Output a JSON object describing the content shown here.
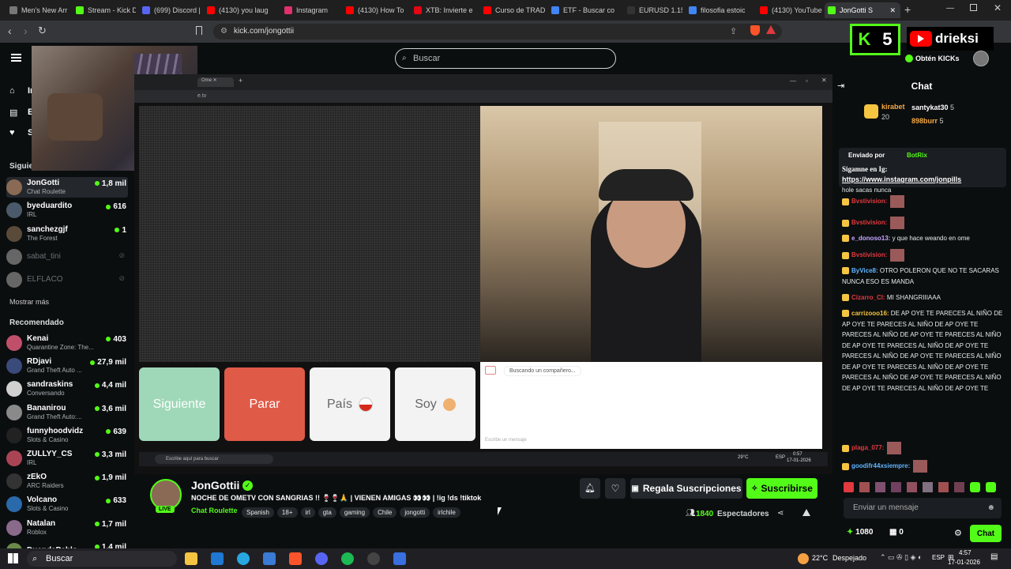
{
  "tabs": [
    {
      "label": "Men's New Arr",
      "color": "#777777"
    },
    {
      "label": "Stream - Kick D",
      "color": "#53fc18"
    },
    {
      "label": "(699) Discord |",
      "color": "#5865f2"
    },
    {
      "label": "(4130) you laug",
      "color": "#ff0000"
    },
    {
      "label": "Instagram",
      "color": "#e1306c"
    },
    {
      "label": "(4130) How To",
      "color": "#ff0000"
    },
    {
      "label": "XTB: Invierte e",
      "color": "#e30613"
    },
    {
      "label": "Curso de TRAD",
      "color": "#ff0000"
    },
    {
      "label": "ETF - Buscar co",
      "color": "#4285f4"
    },
    {
      "label": "EURUSD 1.159",
      "color": "#333333"
    },
    {
      "label": "filosofia estoic",
      "color": "#4285f4"
    },
    {
      "label": "(4130) YouTube",
      "color": "#ff0000"
    },
    {
      "label": "JonGotti S",
      "color": "#53fc18"
    }
  ],
  "address": {
    "url": "kick.com/jongottii"
  },
  "header": {
    "search_placeholder": "Buscar",
    "obtain_kicks": "Obtén KICKs",
    "logo_k": "K",
    "logo_count": "5",
    "yt_overlay": "drieksi"
  },
  "sidebar": {
    "nav": [
      "In",
      "E",
      "S"
    ],
    "following_title": "Siguie",
    "following": [
      {
        "name": "JonGotti",
        "cat": "Chat Roulette",
        "count": "1,8 mil",
        "color": "#8a6a55"
      },
      {
        "name": "byeduardito",
        "cat": "IRL",
        "count": "616",
        "color": "#4a5a6a"
      },
      {
        "name": "sanchezgjf",
        "cat": "The Forest",
        "count": "1",
        "color": "#5a4a3a"
      },
      {
        "name": "sabat_tini",
        "cat": "",
        "count": "",
        "color": "#666666"
      },
      {
        "name": "ELFLACO",
        "cat": "",
        "count": "",
        "color": "#666666"
      }
    ],
    "show_more": "Mostrar más",
    "recommended_title": "Recomendado",
    "recommended": [
      {
        "name": "Kenai",
        "cat": "Quarantine Zone: The...",
        "count": "403",
        "color": "#c0506a"
      },
      {
        "name": "RDjavi",
        "cat": "Grand Theft Auto ...",
        "count": "27,9 mil",
        "color": "#3a4a7a"
      },
      {
        "name": "sandraskins",
        "cat": "Conversando",
        "count": "4,4 mil",
        "color": "#d0d0d0"
      },
      {
        "name": "Bananirou",
        "cat": "Grand Theft Auto:...",
        "count": "3,6 mil",
        "color": "#8a8a8a"
      },
      {
        "name": "funnyhoodvidz",
        "cat": "Slots & Casino",
        "count": "639",
        "color": "#222222"
      },
      {
        "name": "ZULLYY_CS",
        "cat": "IRL",
        "count": "3,3 mil",
        "color": "#aa4455"
      },
      {
        "name": "zEkO",
        "cat": "ARC Raiders",
        "count": "1,9 mil",
        "color": "#333333"
      },
      {
        "name": "Volcano",
        "cat": "Slots & Casino",
        "count": "633",
        "color": "#2a6aaa"
      },
      {
        "name": "Natalan",
        "cat": "Roblox",
        "count": "1,7 mil",
        "color": "#8a6a8a"
      },
      {
        "name": "DuendePablo",
        "cat": "",
        "count": "1,4 mil",
        "color": "#6a8a4a"
      }
    ]
  },
  "player": {
    "buttons": {
      "next": "Siguiente",
      "stop": "Parar",
      "country": "País",
      "soy": "Soy"
    },
    "searching": "Buscando un compañero...",
    "chat_placeholder": "Escribe un mensaje",
    "inner_search": "Escribe aquí para buscar",
    "inner_temp": "29°C",
    "inner_clock": "0:57",
    "inner_date": "17-01-2026",
    "inner_lang": "ESP"
  },
  "stream": {
    "name": "JonGottii",
    "live": "LIVE",
    "title": "NOCHE DE OMETV CON SANGRIAS !! 🍷🍷🙏 | VIENEN AMIGAS 👀👀 | !ig !ds !tiktok",
    "category": "Chat Roulette",
    "tags": [
      "Spanish",
      "18+",
      "irl",
      "gta",
      "gaming",
      "Chile",
      "jongotti",
      "irlchile"
    ],
    "viewers": "1840",
    "viewers_label": "Espectadores",
    "gift_label": "Regala Suscripciones",
    "subscribe_label": "Suscribirse"
  },
  "chat": {
    "title": "Chat",
    "top_gifters": [
      {
        "name": "kirabet",
        "count": "20"
      },
      {
        "name": "santykat30",
        "count": "5"
      },
      {
        "name": "898burr",
        "count": "5"
      }
    ],
    "pinned_by": "Enviado por",
    "pinned_user": "BotRix",
    "pinned_text": "Sigamne en Ig:",
    "pinned_link": "https://www.instagram.com/jonpills",
    "messages": [
      {
        "user": "",
        "text": "hole sacas nunca",
        "ucolor": "#e9ecee"
      },
      {
        "user": "Bvstivision:",
        "text": "",
        "ucolor": "#e0393e"
      },
      {
        "user": "Bvstivision:",
        "text": "",
        "ucolor": "#e0393e"
      },
      {
        "user": "e_donoso13:",
        "text": " y que hace weando en ome",
        "ucolor": "#c7a5ff"
      },
      {
        "user": "Bvstivision:",
        "text": "",
        "ucolor": "#e0393e"
      },
      {
        "user": "ByVice8:",
        "text": " OTRO POLERON QUE NO TE SACARAS NUNCA ESO ES MANDA",
        "ucolor": "#5fb4ff"
      },
      {
        "user": "Cizarro_Cl:",
        "text": " MI SHANGRIIIAAA",
        "ucolor": "#e0393e"
      },
      {
        "user": "carrizooo16:",
        "text": " DE AP OYE TE PARECES AL NIÑO DE AP OYE TE PARECES AL NIÑO DE AP OYE TE PARECES AL NIÑO DE AP OYE TE PARECES AL NIÑO DE AP OYE TE PARECES AL NIÑO DE AP OYE TE PARECES AL NIÑO DE AP OYE TE PARECES AL NIÑO DE AP OYE TE PARECES AL NIÑO DE AP OYE TE PARECES AL NIÑO DE AP OYE TE PARECES AL NIÑO DE AP OYE TE PARECES AL NIÑO DE AP OYE TE",
        "ucolor": "#f5c542"
      },
      {
        "user": "plaga_077:",
        "text": "",
        "ucolor": "#e0393e"
      },
      {
        "user": "goodifr44xsiempre:",
        "text": "",
        "ucolor": "#5fb4ff"
      }
    ],
    "input_placeholder": "Enviar un mensaje",
    "points": "1080",
    "coins": "0",
    "send_label": "Chat"
  },
  "taskbar": {
    "search": "Buscar",
    "weather": "22°C",
    "weather_desc": "Despejado",
    "lang": "ESP",
    "time": "4:57",
    "date": "17-01-2026"
  },
  "colors": {
    "kick_green": "#53fc18",
    "stop_red": "#e05a48",
    "next_green": "#9fd8b8"
  }
}
